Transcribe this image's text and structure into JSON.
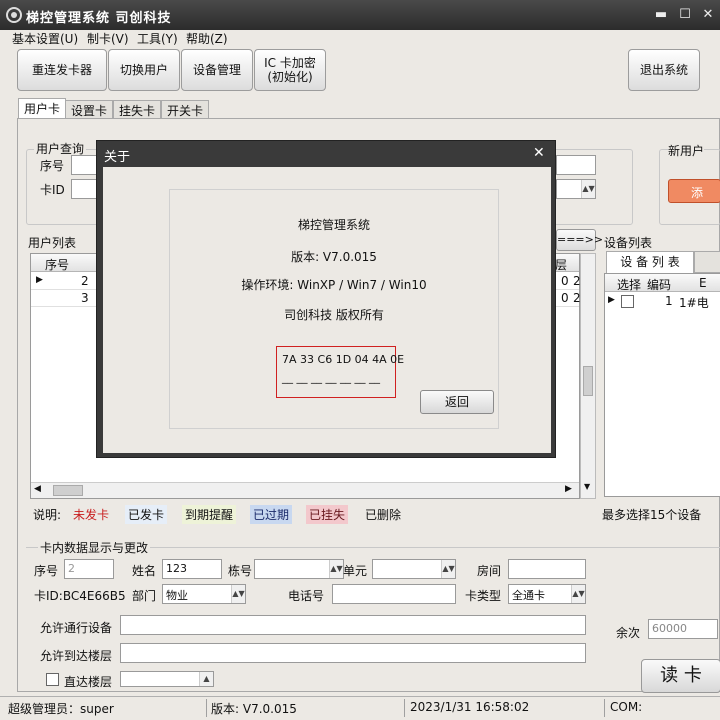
{
  "app": {
    "title": "梯控管理系统   司创科技",
    "window_buttons": {
      "minimize": "▬",
      "maximize": "☐",
      "close": "✕"
    }
  },
  "menu": [
    "基本设置(U)",
    "制卡(V)",
    "工具(Y)",
    "帮助(Z)"
  ],
  "toolbar": {
    "reconnect": "重连发卡器",
    "switch_user": "切换用户",
    "device_mgmt": "设备管理",
    "ic_encrypt_l1": "IC 卡加密",
    "ic_encrypt_l2": "(初始化)",
    "exit": "退出系统"
  },
  "tabs": [
    "用户卡",
    "设置卡",
    "挂失卡",
    "开关卡"
  ],
  "user_query": {
    "title": "用户查询",
    "seq_label": "序号",
    "cardid_label": "卡ID",
    "new_user_title": "新用户",
    "add_btn_partial": "添"
  },
  "user_list": {
    "title": "用户列表",
    "columns": [
      "序号"
    ],
    "rows": [
      {
        "seq": "2",
        "tail1": "0",
        "tail2": "2"
      },
      {
        "seq": "3",
        "tail1": "0",
        "tail2": "2"
      }
    ],
    "right_col_partial": "楼层",
    "arrow_btn": "===>>"
  },
  "device_list": {
    "title": "设备列表",
    "tab": "设 备 列 表",
    "columns": [
      "选择",
      "编码",
      "E"
    ],
    "rows": [
      {
        "code": "1",
        "name": "1#电"
      }
    ],
    "max_note": "最多选择15个设备"
  },
  "legend": {
    "label": "说明:",
    "items": [
      {
        "text": "未发卡",
        "bg": "",
        "color": "#c81e1e"
      },
      {
        "text": "已发卡",
        "bg": "#e6eef8",
        "color": "#111111"
      },
      {
        "text": "到期提醒",
        "bg": "#eef3d8",
        "color": "#111111"
      },
      {
        "text": "已过期",
        "bg": "#c8d8f0",
        "color": "#1a2a6a"
      },
      {
        "text": "已挂失",
        "bg": "#f3c8cc",
        "color": "#6a1a20"
      },
      {
        "text": "已删除",
        "bg": "",
        "color": "#111111"
      }
    ]
  },
  "card_data": {
    "title": "卡内数据显示与更改",
    "seq_label": "序号",
    "seq_value": "2",
    "name_label": "姓名",
    "name_value": "123",
    "building_label": "栋号",
    "unit_label": "单元",
    "room_label": "房间",
    "cardid_text": "卡ID:BC4E66B5",
    "dept_label": "部门",
    "dept_value": "物业",
    "phone_label": "电话号",
    "cardtype_label": "卡类型",
    "cardtype_value": "全通卡",
    "balance_label": "余次",
    "balance_value": "60000",
    "allowed_devices_label": "允许通行设备",
    "allowed_floors_label": "允许到达楼层",
    "direct_floor_label": "直达楼层",
    "read_btn": "读 卡"
  },
  "status": {
    "user": "超级管理员：super",
    "version": "版本: V7.0.015",
    "datetime": "2023/1/31 16:58:02",
    "com": "COM:"
  },
  "about": {
    "title": "关于",
    "close": "✕",
    "app_name": "梯控管理系统",
    "version": "版本: V7.0.015",
    "env": "操作环境: WinXP / Win7 / Win10",
    "copyright": "司创科技 版权所有",
    "key": "7A 33 C6 1D 04 4A 0E",
    "key_line2": "__ __ __ __ __ __ __",
    "back_btn": "返回"
  }
}
